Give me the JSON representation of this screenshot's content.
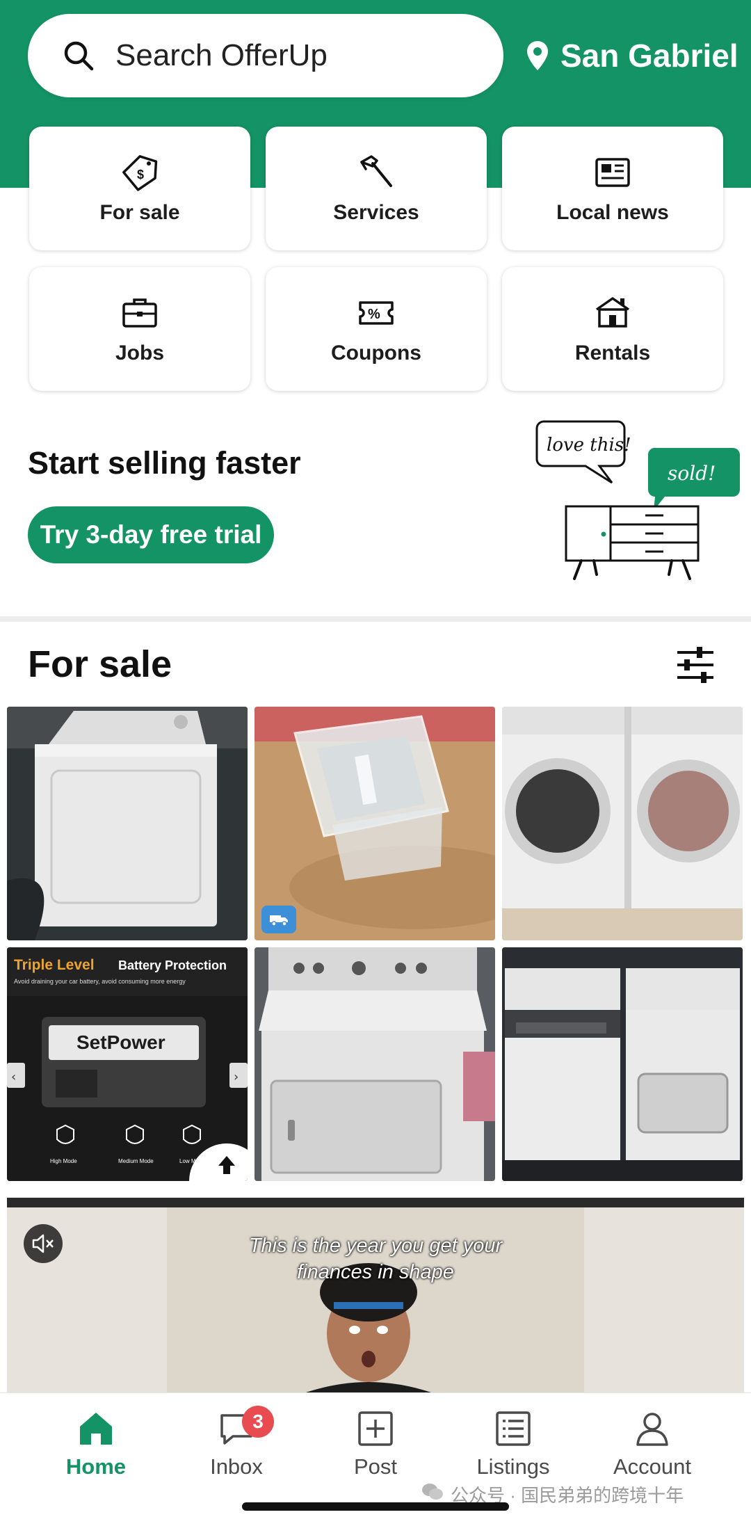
{
  "header": {
    "search_placeholder": "Search OfferUp",
    "location": "San Gabriel"
  },
  "categories": [
    {
      "label": "For sale",
      "icon": "price-tag-icon"
    },
    {
      "label": "Services",
      "icon": "hammer-icon"
    },
    {
      "label": "Local news",
      "icon": "newspaper-icon"
    },
    {
      "label": "Jobs",
      "icon": "briefcase-icon"
    },
    {
      "label": "Coupons",
      "icon": "coupon-icon"
    },
    {
      "label": "Rentals",
      "icon": "house-icon"
    }
  ],
  "promo": {
    "title": "Start selling faster",
    "button": "Try 3-day free trial",
    "bubble_left": "love this!",
    "bubble_right": "sold!"
  },
  "for_sale": {
    "title": "For sale",
    "filter_icon": "sliders-icon",
    "items": [
      {
        "subject": "white dryer"
      },
      {
        "subject": "clear plastic food container",
        "badge": "shipping-truck-icon"
      },
      {
        "subject": "front-load washer and dryer"
      },
      {
        "subject": "SetPower battery ad",
        "ad_headline_1": "Triple Level",
        "ad_headline_2": "Battery Protection",
        "ad_subline": "Avoid draining your car battery, avoid consuming more energy",
        "ad_brand": "SetPower",
        "modes": [
          "High Mode",
          "Medium Mode",
          "Low Mode"
        ]
      },
      {
        "subject": "top-load dryer"
      },
      {
        "subject": "LG washer and dryer"
      }
    ]
  },
  "video_ad": {
    "caption_line1": "This is the year you get your",
    "caption_line2": "finances in shape",
    "mute_icon": "speaker-muted-icon"
  },
  "tabbar": {
    "tabs": [
      {
        "label": "Home",
        "icon": "home-icon",
        "active": true
      },
      {
        "label": "Inbox",
        "icon": "chat-bubble-icon",
        "badge": "3"
      },
      {
        "label": "Post",
        "icon": "plus-square-icon"
      },
      {
        "label": "Listings",
        "icon": "list-icon"
      },
      {
        "label": "Account",
        "icon": "person-icon"
      }
    ]
  },
  "watermark": "公众号 · 国民弟弟的跨境十年",
  "colors": {
    "brand": "#149366",
    "badge": "#e84b50",
    "ship_badge": "#3d8fd8"
  }
}
